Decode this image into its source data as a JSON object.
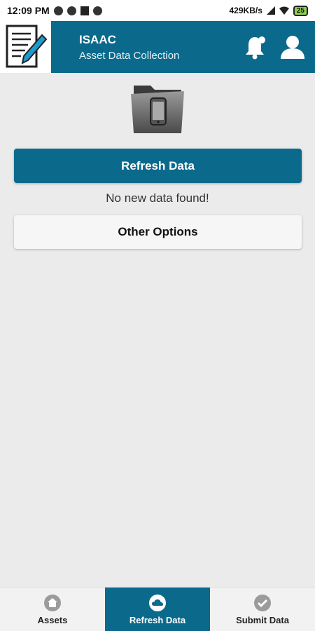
{
  "status_bar": {
    "time": "12:09 PM",
    "network_speed": "429KB/s",
    "battery": "25"
  },
  "header": {
    "title": "ISAAC",
    "subtitle": "Asset Data Collection"
  },
  "main": {
    "refresh_label": "Refresh Data",
    "status_message": "No new data found!",
    "other_options_label": "Other Options"
  },
  "bottom_nav": {
    "items": [
      {
        "label": "Assets",
        "icon": "home-icon",
        "active": false
      },
      {
        "label": "Refresh Data",
        "icon": "cloud-icon",
        "active": true
      },
      {
        "label": "Submit Data",
        "icon": "check-icon",
        "active": false
      }
    ]
  },
  "colors": {
    "primary": "#0b6a8c",
    "background": "#ebebeb"
  }
}
